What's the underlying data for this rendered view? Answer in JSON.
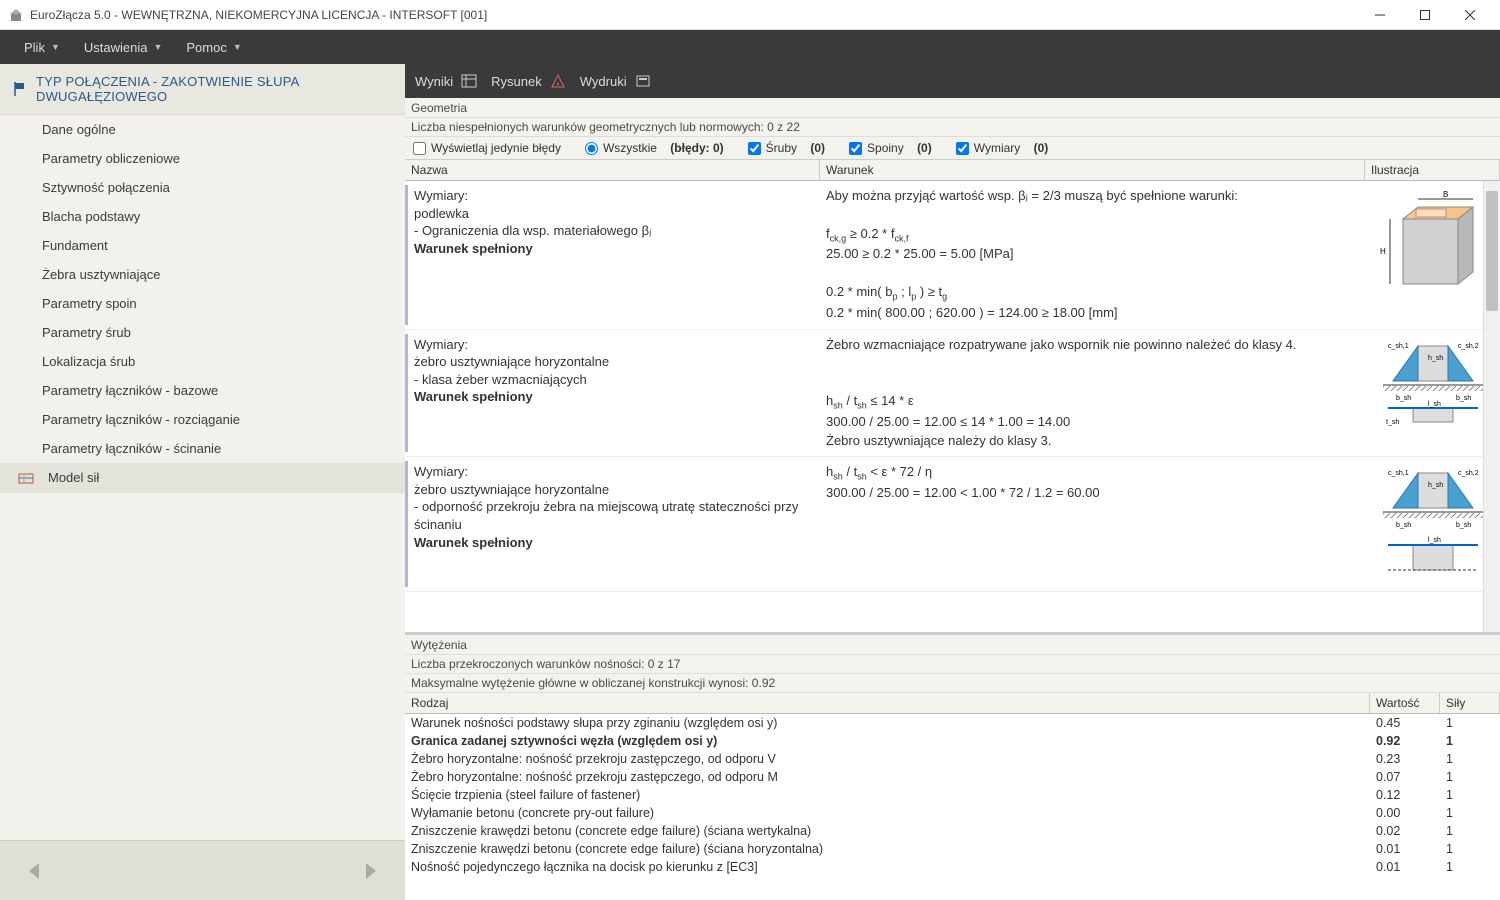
{
  "window": {
    "title": "EuroZłącza 5.0 - WEWNĘTRZNA, NIEKOMERCYJNA LICENCJA - INTERSOFT [001]"
  },
  "menubar": {
    "items": [
      {
        "label": "Plik",
        "has_dropdown": true
      },
      {
        "label": "Ustawienia",
        "has_dropdown": true
      },
      {
        "label": "Pomoc",
        "has_dropdown": true
      }
    ]
  },
  "sidebar": {
    "type_header": "Typ połączenia - ZAKOTWIENIE SŁUPA DWUGAŁĘZIOWEGO",
    "items": [
      "Dane ogólne",
      "Parametry obliczeniowe",
      "Sztywność połączenia",
      "Blacha podstawy",
      "Fundament",
      "Żebra usztywniające",
      "Parametry spoin",
      "Parametry śrub",
      "Lokalizacja śrub",
      "Parametry łączników - bazowe",
      "Parametry łączników - rozciąganie",
      "Parametry łączników - ścinanie"
    ],
    "model_section": "Model sił"
  },
  "toolbar": {
    "items": [
      "Wyniki",
      "Rysunek",
      "Wydruki"
    ]
  },
  "geometry_panel": {
    "title": "Geometria",
    "subtitle": "Liczba niespełnionych warunków geometrycznych lub normowych: 0 z 22",
    "filters": {
      "errors_only": "Wyświetlaj jedynie błędy",
      "all": "Wszystkie",
      "all_bold": "(błędy: 0)",
      "sruby": "Śruby",
      "sruby_count": "(0)",
      "spoiny": "Spoiny",
      "spoiny_count": "(0)",
      "wymiary": "Wymiary",
      "wymiary_count": "(0)"
    },
    "columns": {
      "nazwa": "Nazwa",
      "warunek": "Warunek",
      "ilustr": "Ilustracja"
    }
  },
  "results": [
    {
      "nazwa_lines": [
        "Wymiary:",
        "podlewka",
        "- Ograniczenia dla wsp. materiałowego βⱼ"
      ],
      "nazwa_bold": "Warunek spełniony",
      "warunek_pre": "Aby można przyjąć wartość wsp. βⱼ = 2/3 muszą być spełnione warunki:",
      "warunek_lines": [
        "f_ck,g ≥ 0.2 * f_ck,f",
        "25.00 ≥ 0.2 * 25.00 = 5.00 [MPa]",
        "",
        "0.2 * min( b_p  ;  l_p ) ≥ t_g",
        "0.2 * min( 800.00  ;  620.00 ) = 124.00 ≥ 18.00 [mm]"
      ],
      "illus": "cube"
    },
    {
      "nazwa_lines": [
        "Wymiary:",
        "żebro usztywniające horyzontalne",
        "- klasa żeber wzmacniających"
      ],
      "nazwa_bold": "Warunek spełniony",
      "warunek_pre": "Żebro wzmacniające rozpatrywane jako wspornik nie powinno należeć do klasy 4.",
      "warunek_lines": [
        "",
        "h_sh / t_sh ≤ 14 * ε",
        "300.00 / 25.00 = 12.00 ≤ 14 * 1.00 = 14.00",
        "Żebro usztywniające należy do klasy 3."
      ],
      "illus": "stiffener"
    },
    {
      "nazwa_lines": [
        "Wymiary:",
        "żebro usztywniające horyzontalne",
        "- odporność przekroju żebra na miejscową utratę stateczności przy ścinaniu"
      ],
      "nazwa_bold": "Warunek spełniony",
      "warunek_pre": "",
      "warunek_lines": [
        "h_sh / t_sh < ε * 72 / η",
        "300.00 / 25.00 = 12.00 < 1.00 * 72 / 1.2 = 60.00"
      ],
      "illus": "stiffener2"
    }
  ],
  "capacity_panel": {
    "title": "Wytężenia",
    "line1": "Liczba przekroczonych warunków nośności: 0 z 17",
    "line2": "Maksymalne wytężenie główne w obliczanej konstrukcji wynosi: 0.92",
    "columns": {
      "rodzaj": "Rodzaj",
      "wartosc": "Wartość",
      "sily": "Siły"
    },
    "rows": [
      {
        "rodzaj": "Warunek nośności podstawy słupa przy zginaniu (względem osi y)",
        "wartosc": "0.45",
        "sily": "1",
        "bold": false
      },
      {
        "rodzaj": "Granica zadanej sztywności węzła (względem osi y)",
        "wartosc": "0.92",
        "sily": "1",
        "bold": true
      },
      {
        "rodzaj": "Żebro horyzontalne: nośność przekroju zastępczego, od odporu V",
        "wartosc": "0.23",
        "sily": "1",
        "bold": false
      },
      {
        "rodzaj": "Żebro horyzontalne: nośność przekroju zastępczego, od odporu M",
        "wartosc": "0.07",
        "sily": "1",
        "bold": false
      },
      {
        "rodzaj": "Ścięcie trzpienia (steel failure of fastener)",
        "wartosc": "0.12",
        "sily": "1",
        "bold": false
      },
      {
        "rodzaj": "Wyłamanie betonu (concrete pry-out failure)",
        "wartosc": "0.00",
        "sily": "1",
        "bold": false
      },
      {
        "rodzaj": "Zniszczenie krawędzi betonu (concrete edge failure) (ściana wertykalna)",
        "wartosc": "0.02",
        "sily": "1",
        "bold": false
      },
      {
        "rodzaj": "Zniszczenie krawędzi betonu (concrete edge failure) (ściana horyzontalna)",
        "wartosc": "0.01",
        "sily": "1",
        "bold": false
      },
      {
        "rodzaj": "Nośność pojedynczego łącznika na docisk po kierunku z [EC3]",
        "wartosc": "0.01",
        "sily": "1",
        "bold": false
      }
    ]
  }
}
